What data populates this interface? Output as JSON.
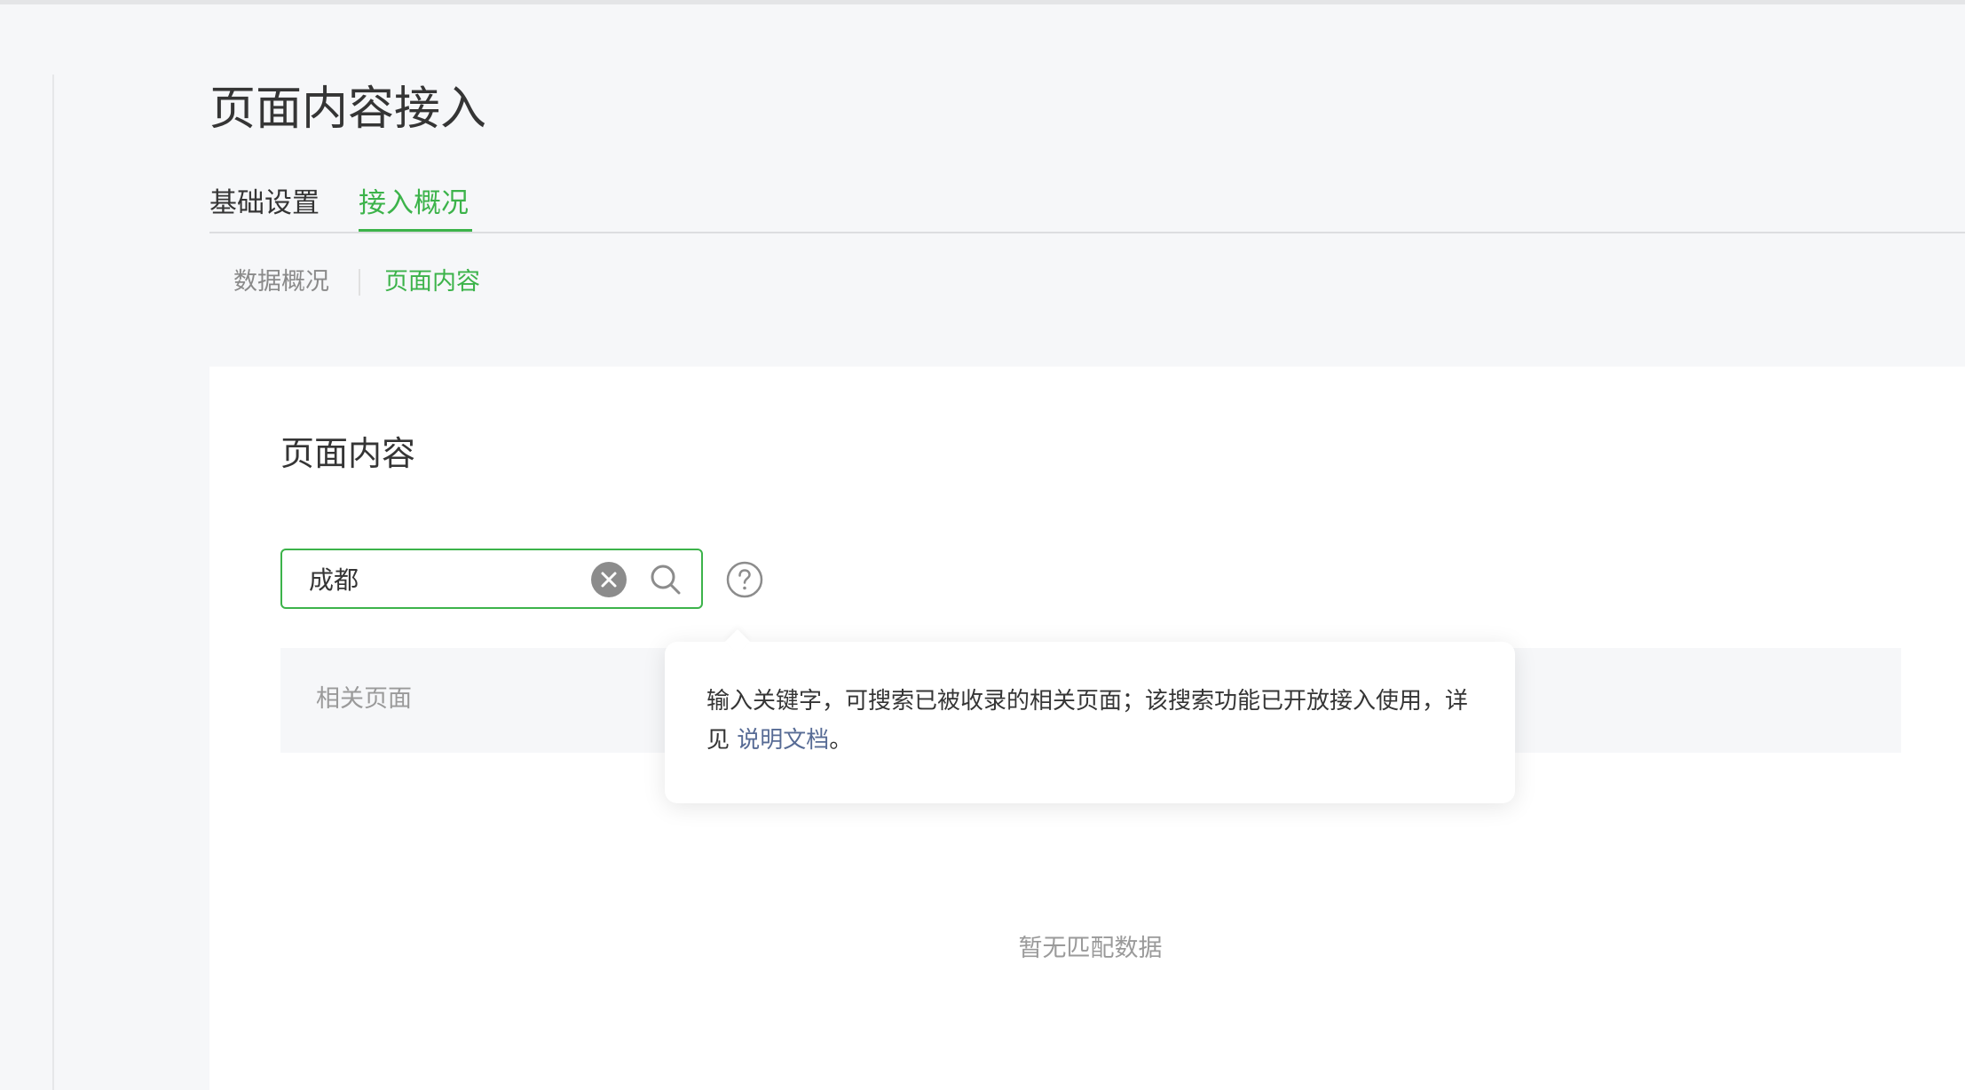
{
  "page": {
    "title": "页面内容接入"
  },
  "tabs": [
    {
      "label": "基础设置",
      "active": false
    },
    {
      "label": "接入概况",
      "active": true
    }
  ],
  "subtabs": [
    {
      "label": "数据概况",
      "active": false
    },
    {
      "label": "页面内容",
      "active": true
    }
  ],
  "panel": {
    "title": "页面内容",
    "search": {
      "value": "成都"
    },
    "table": {
      "header": "相关页面"
    },
    "empty_text": "暂无匹配数据"
  },
  "tooltip": {
    "text_before": "输入关键字，可搜索已被收录的相关页面；该搜索功能已开放接入使用，详见 ",
    "link_text": "说明文档",
    "text_after": "。"
  },
  "icons": {
    "clear": "clear-icon",
    "search": "search-icon",
    "help": "help-icon"
  },
  "colors": {
    "accent": "#3cb34a",
    "link": "#576b95",
    "background": "#f6f7f9",
    "panel": "#ffffff"
  }
}
